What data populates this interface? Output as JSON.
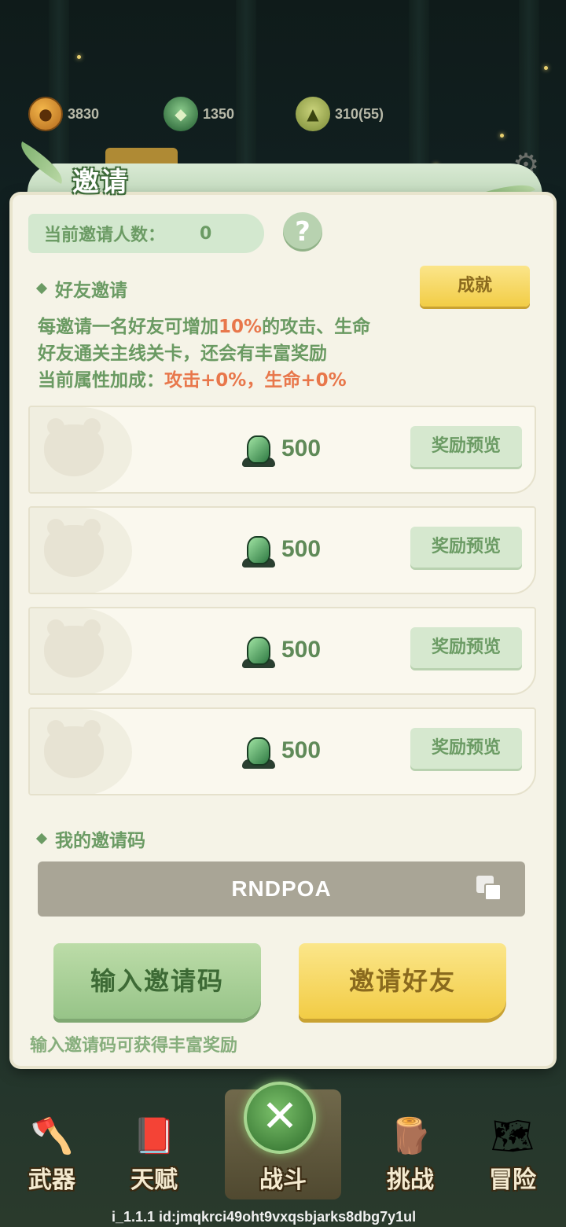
{
  "resources": [
    {
      "icon": "paw-coin-icon",
      "value": "3830"
    },
    {
      "icon": "green-crystal-icon",
      "value": "1350"
    },
    {
      "icon": "bamboo-shoot-icon",
      "value": "310(55)"
    }
  ],
  "dialog": {
    "title": "邀请",
    "invite_count_label": "当前邀请人数：",
    "invite_count_value": "0",
    "help_label": "?",
    "friend_section_title": "好友邀请",
    "achievement_button": "成就",
    "desc_line1_a": "每邀请一名好友可增加",
    "desc_line1_highlight": "10%",
    "desc_line1_b": "的攻击、生命",
    "desc_line2": "好友通关主线关卡，还会有丰富奖励",
    "desc_line3_a": "当前属性加成：",
    "desc_line3_highlight": "攻击+0%，生命+0%",
    "reward_slots": [
      {
        "amount": "500",
        "preview_label": "奖励预览"
      },
      {
        "amount": "500",
        "preview_label": "奖励预览"
      },
      {
        "amount": "500",
        "preview_label": "奖励预览"
      },
      {
        "amount": "500",
        "preview_label": "奖励预览"
      }
    ],
    "my_code_title": "我的邀请码",
    "invite_code": "RNDPOA",
    "enter_code_button": "输入邀请码",
    "invite_friend_button": "邀请好友",
    "footer_note": "输入邀请码可获得丰富奖励"
  },
  "nav": [
    {
      "label": "武器",
      "icon": "axe-icon"
    },
    {
      "label": "天赋",
      "icon": "paw-book-icon"
    },
    {
      "label": "战斗",
      "icon": "scroll-icon"
    },
    {
      "label": "挑战",
      "icon": "wooden-dummy-icon"
    },
    {
      "label": "冒险",
      "icon": "map-icon"
    }
  ],
  "close_label": "✕",
  "build_id": "i_1.1.1 id:jmqkrci49oht9vxqsbjarks8dbg7y1ul",
  "colors": {
    "accent_green": "#6b9b64",
    "highlight_orange": "#e8774b",
    "yellow_button": "#f2cd46"
  }
}
